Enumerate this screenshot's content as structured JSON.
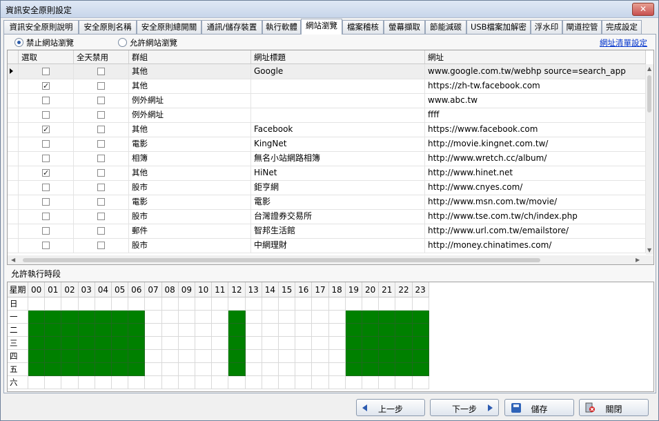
{
  "window": {
    "title": "資訊安全原則設定",
    "close_label": "✕"
  },
  "tabs": [
    "資訊安全原則說明",
    "安全原則名稱",
    "安全原則總開關",
    "通訊/儲存裝置",
    "執行軟體",
    "網站瀏覽",
    "檔案稽核",
    "螢幕擷取",
    "節能減碳",
    "USB檔案加解密",
    "浮水印",
    "閘道控管",
    "完成設定"
  ],
  "active_tab": 5,
  "mode": {
    "block_label": "禁止網站瀏覽",
    "allow_label": "允許網站瀏覽",
    "selected": "block"
  },
  "url_list_link": "網址清單設定",
  "grid": {
    "columns": [
      "選取",
      "全天禁用",
      "群組",
      "網址標題",
      "網址"
    ],
    "rows": [
      {
        "select": false,
        "allday": false,
        "group": "其他",
        "title": "Google",
        "url": "www.google.com.tw/webhp source=search_app"
      },
      {
        "select": true,
        "allday": false,
        "group": "其他",
        "title": "",
        "url": "https://zh-tw.facebook.com"
      },
      {
        "select": false,
        "allday": false,
        "group": "例外網址",
        "title": "",
        "url": "www.abc.tw"
      },
      {
        "select": false,
        "allday": false,
        "group": "例外網址",
        "title": "",
        "url": "ffff"
      },
      {
        "select": true,
        "allday": false,
        "group": "其他",
        "title": "Facebook",
        "url": "https://www.facebook.com"
      },
      {
        "select": false,
        "allday": false,
        "group": "電影",
        "title": "KingNet",
        "url": "http://movie.kingnet.com.tw/"
      },
      {
        "select": false,
        "allday": false,
        "group": "相簿",
        "title": "無名小站網路相簿",
        "url": "http://www.wretch.cc/album/"
      },
      {
        "select": true,
        "allday": false,
        "group": "其他",
        "title": "HiNet",
        "url": "http://www.hinet.net"
      },
      {
        "select": false,
        "allday": false,
        "group": "股市",
        "title": "鉅亨網",
        "url": "http://www.cnyes.com/"
      },
      {
        "select": false,
        "allday": false,
        "group": "電影",
        "title": "電影",
        "url": "http://www.msn.com.tw/movie/"
      },
      {
        "select": false,
        "allday": false,
        "group": "股市",
        "title": "台灣證券交易所",
        "url": "http://www.tse.com.tw/ch/index.php"
      },
      {
        "select": false,
        "allday": false,
        "group": "郵件",
        "title": "智邦生活館",
        "url": "http://www.url.com.tw/emailstore/"
      },
      {
        "select": false,
        "allday": false,
        "group": "股市",
        "title": "中網理財",
        "url": "http://money.chinatimes.com/"
      }
    ]
  },
  "schedule": {
    "label": "允許執行時段",
    "corner": "星期",
    "hours": [
      "00",
      "01",
      "02",
      "03",
      "04",
      "05",
      "06",
      "07",
      "08",
      "09",
      "10",
      "11",
      "12",
      "13",
      "14",
      "15",
      "16",
      "17",
      "18",
      "19",
      "20",
      "21",
      "22",
      "23"
    ],
    "days": [
      {
        "name": "日",
        "on": []
      },
      {
        "name": "一",
        "on": [
          0,
          1,
          2,
          3,
          4,
          5,
          6,
          12,
          19,
          20,
          21,
          22,
          23
        ]
      },
      {
        "name": "二",
        "on": [
          0,
          1,
          2,
          3,
          4,
          5,
          6,
          12,
          19,
          20,
          21,
          22,
          23
        ]
      },
      {
        "name": "三",
        "on": [
          0,
          1,
          2,
          3,
          4,
          5,
          6,
          12,
          19,
          20,
          21,
          22,
          23
        ]
      },
      {
        "name": "四",
        "on": [
          0,
          1,
          2,
          3,
          4,
          5,
          6,
          12,
          19,
          20,
          21,
          22,
          23
        ]
      },
      {
        "name": "五",
        "on": [
          0,
          1,
          2,
          3,
          4,
          5,
          6,
          12,
          19,
          20,
          21,
          22,
          23
        ]
      },
      {
        "name": "六",
        "on": []
      }
    ],
    "on_color": "#008000"
  },
  "buttons": {
    "prev": "上一步",
    "next": "下一步",
    "save": "儲存",
    "close": "關閉"
  }
}
